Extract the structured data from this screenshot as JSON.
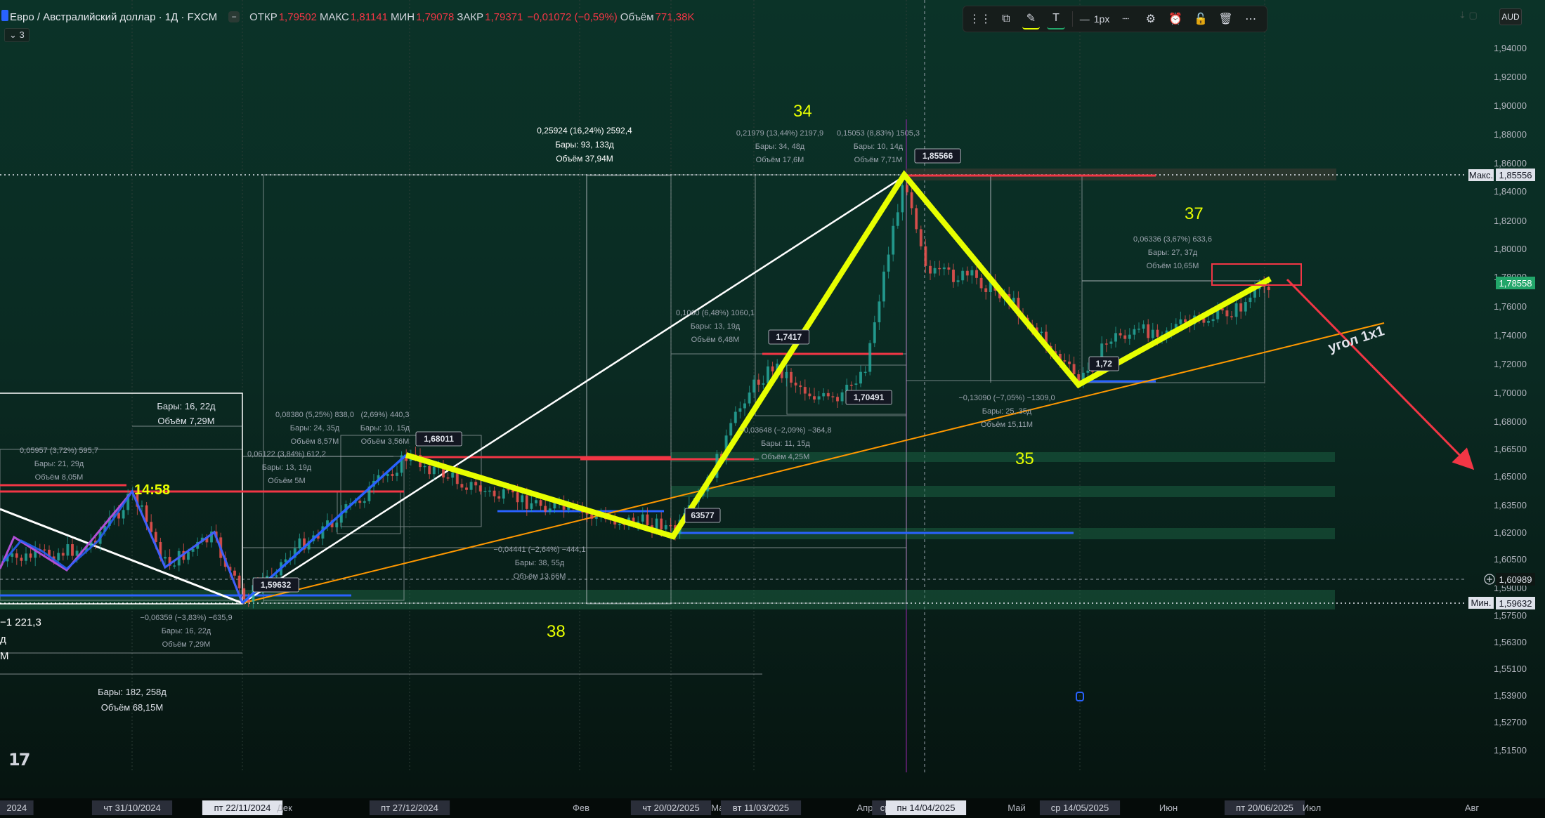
{
  "header": {
    "symbol": "Евро / Австралийский доллар · 1Д · FXCM",
    "open_label": "ОТКР",
    "open": "1,79502",
    "high_label": "МАКС",
    "high": "1,81141",
    "low_label": "МИН",
    "low": "1,79078",
    "close_label": "ЗАКР",
    "close": "1,79371",
    "change": "−0,01072 (−0,59%)",
    "volume_label": "Объём",
    "volume": "771,38K",
    "indicator_count": "3"
  },
  "toolbar": {
    "width_label": "1px",
    "currency": "AUD"
  },
  "colors": {
    "background": "#0b3328",
    "yellow": "#e7ff00",
    "red": "#f23645",
    "blue": "#2962ff",
    "orange": "#ff9800",
    "white": "#ffffff",
    "purple": "#9c27b0",
    "candle_up": "#26a69a",
    "candle_down": "#ef5350"
  },
  "chart_data": {
    "type": "candlestick",
    "title": "Евро / Австралийский доллар · 1Д · FXCM",
    "price_axis": {
      "ticks": [
        "1,94000",
        "1,92000",
        "1,90000",
        "1,88000",
        "1,86000",
        "1,84000",
        "1,82000",
        "1,80000",
        "1,78000",
        "1,76000",
        "1,74000",
        "1,72000",
        "1,70000",
        "1,68000",
        "1,66500",
        "1,65000",
        "1,63500",
        "1,62000",
        "1,60500",
        "1,59000",
        "1,57500",
        "1,56300",
        "1,55100",
        "1,53900",
        "1,52700",
        "1,51500"
      ],
      "max_label": "Макс.",
      "max_value": "1,85556",
      "min_label": "Мин.",
      "min_value": "1,59632",
      "current_value": "1,78558",
      "crosshair_value": "1,60989"
    },
    "time_axis": {
      "ticks": [
        {
          "label": "2024",
          "boxed": true
        },
        {
          "label": "чт 31/10/2024",
          "boxed": true
        },
        {
          "label": "пт 22/11/2024",
          "boxed": true,
          "highlight": true
        },
        {
          "label": "Дек",
          "boxed": false
        },
        {
          "label": "пт 27/12/2024",
          "boxed": true
        },
        {
          "label": "Фев",
          "boxed": false
        },
        {
          "label": "чт 20/02/2025",
          "boxed": true
        },
        {
          "label": "Мар",
          "boxed": false
        },
        {
          "label": "вт 11/03/2025",
          "boxed": true
        },
        {
          "label": "Апр",
          "boxed": false
        },
        {
          "label": "ср 0",
          "boxed": true
        },
        {
          "label": "пн 14/04/2025",
          "boxed": true,
          "highlight": true
        },
        {
          "label": "Май",
          "boxed": false
        },
        {
          "label": "ср 14/05/2025",
          "boxed": true
        },
        {
          "label": "Июн",
          "boxed": false
        },
        {
          "label": "пт 20/06/2025",
          "boxed": true
        },
        {
          "label": "Июл",
          "boxed": false
        },
        {
          "label": "Авг",
          "boxed": false
        }
      ]
    },
    "wave_labels": [
      "34",
      "35",
      "37",
      "38"
    ],
    "price_labels": [
      "1,85566",
      "1,68011",
      "1,7417",
      "1,70491",
      "63577",
      "1,59632",
      "1,72"
    ],
    "annotations": {
      "big": [
        "0,25924 (16,24%) 2592,4",
        "Бары: 93, 133д",
        "Объём 37,94M"
      ],
      "top": [
        "0,21979 (13,44%) 2197,9",
        "Бары: 34, 48д",
        "Объём 17,6M"
      ],
      "top2": [
        "0,15053 (8,83%) 1505,3",
        "Бары: 10, 14д",
        "Объём 7,71M"
      ],
      "r37": [
        "0,06336 (3,67%) 633,6",
        "Бары: 27, 37д",
        "Объём 10,65M"
      ],
      "m1060": [
        "0,1060 (6,48%) 1060,1",
        "Бары: 13, 19д",
        "Объём 6,48M"
      ],
      "m364": [
        "−0,03648 (−2,09%) −364,8",
        "Бары: 11, 15д",
        "Объём 4,25M"
      ],
      "m1309": [
        "−0,13090 (−7,05%) −1309,0",
        "Бары: 25, 35д",
        "Объём 15,11M"
      ],
      "m440": [
        "0,08380 (5,25%) 838,0",
        "Бары: 24, 35д",
        "Объём 8,57M"
      ],
      "m440b": [
        "(2,69%) 440,3",
        "Бары: 10, 15д",
        "Объём 3,56M"
      ],
      "m612": [
        "0,06122 (3,84%) 612,2",
        "Бары: 13, 19д",
        "Объём 5M"
      ],
      "m595": [
        "0,05957 (3,72%) 595,7",
        "Бары: 21, 29д",
        "Объём 8,05M"
      ],
      "m444": [
        "−0,04441 (−2,64%) −444,1",
        "Бары: 38, 55д",
        "Объём 13,66M"
      ],
      "m635": [
        "−0,06359 (−3,83%) −635,9",
        "Бары: 16, 22д",
        "Объём 7,29M"
      ],
      "box_left": [
        "Бары: 16, 22д",
        "Объём 7,29M"
      ],
      "bottom": [
        "Бары: 182, 258д",
        "Объём 68,15M"
      ],
      "left_edge": [
        "−1 221,3",
        "д",
        "M"
      ]
    },
    "time_marker": "14:58",
    "angle_label": "угол 1x1"
  }
}
